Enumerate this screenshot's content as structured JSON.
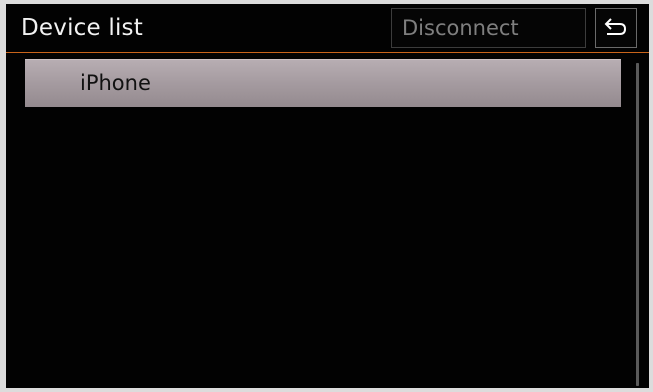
{
  "header": {
    "title": "Device list",
    "disconnect_label": "Disconnect",
    "back_icon": "back-arrow-icon"
  },
  "devices": [
    {
      "label": "iPhone",
      "selected": true
    }
  ],
  "colors": {
    "accent_line": "#c9641a",
    "background": "#020202",
    "selected_item": "#a59ba0"
  }
}
